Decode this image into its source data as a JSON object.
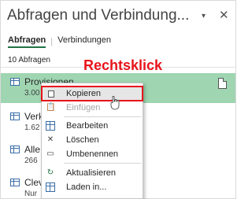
{
  "pane": {
    "title": "Abfragen und Verbindung...",
    "dropdown_glyph": "▾",
    "close_glyph": "✕"
  },
  "tabs": [
    {
      "label": "Abfragen",
      "active": true
    },
    {
      "label": "Verbindungen",
      "active": false
    }
  ],
  "count_label": "10 Abfragen",
  "annotation": "Rechtsklick",
  "queries": [
    {
      "name": "Provisionen",
      "sub": "3.00",
      "selected": true
    },
    {
      "name": "Verk",
      "sub": "1.62",
      "selected": false
    },
    {
      "name": "Alle",
      "sub": "266",
      "selected": false
    },
    {
      "name": "Clev",
      "sub": "Nur",
      "selected": false
    }
  ],
  "context_menu": {
    "items": [
      {
        "label": "Kopieren",
        "icon": "copy-icon",
        "highlighted": true,
        "disabled": false
      },
      {
        "label": "Einfügen",
        "icon": "paste-icon",
        "highlighted": false,
        "disabled": true
      },
      {
        "label": "Bearbeiten",
        "icon": "edit-icon",
        "highlighted": false,
        "disabled": false
      },
      {
        "label": "Löschen",
        "icon": "delete-icon",
        "highlighted": false,
        "disabled": false
      },
      {
        "label": "Umbenennen",
        "icon": "rename-icon",
        "highlighted": false,
        "disabled": false
      },
      {
        "label": "Aktualisieren",
        "icon": "refresh-icon",
        "highlighted": false,
        "disabled": false
      },
      {
        "label": "Laden in...",
        "icon": "load-icon",
        "highlighted": false,
        "disabled": false
      }
    ]
  },
  "colors": {
    "selection": "#9fd5b1",
    "annotation": "#e8141b",
    "accent": "#217346"
  }
}
